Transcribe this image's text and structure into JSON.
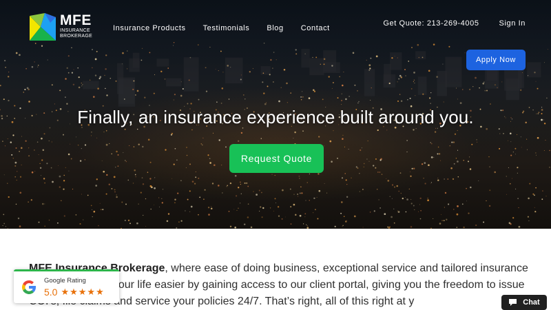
{
  "brand": {
    "name": "MFE",
    "sub_line1": "INSURANCE",
    "sub_line2": "BROKERAGE"
  },
  "nav": {
    "items": [
      {
        "label": "Insurance Products"
      },
      {
        "label": "Testimonials"
      },
      {
        "label": "Blog"
      },
      {
        "label": "Contact"
      }
    ],
    "quote_phone": "Get Quote: 213-269-4005",
    "sign_in": "Sign In",
    "apply_now": "Apply Now"
  },
  "hero": {
    "headline": "Finally, an insurance experience built around you.",
    "cta": "Request Quote"
  },
  "intro": {
    "company": "MFE Insurance Brokerage",
    "text": ", where ease of doing business, exceptional service and tailored insurance concierge. Make your life easier by gaining access to our client portal, giving you the freedom to issue COI’s, file claims and service your policies 24/7. That’s right, all of this right at y"
  },
  "google_rating": {
    "label": "Google Rating",
    "score": "5.0",
    "stars": 5,
    "icon": "google-g-icon"
  },
  "chat": {
    "label": "Chat",
    "icon": "speech-bubble-icon"
  },
  "colors": {
    "apply_button": "#1d63e0",
    "quote_button": "#18c157",
    "rating_accent": "#e8710a",
    "chat_bg": "#202020"
  }
}
